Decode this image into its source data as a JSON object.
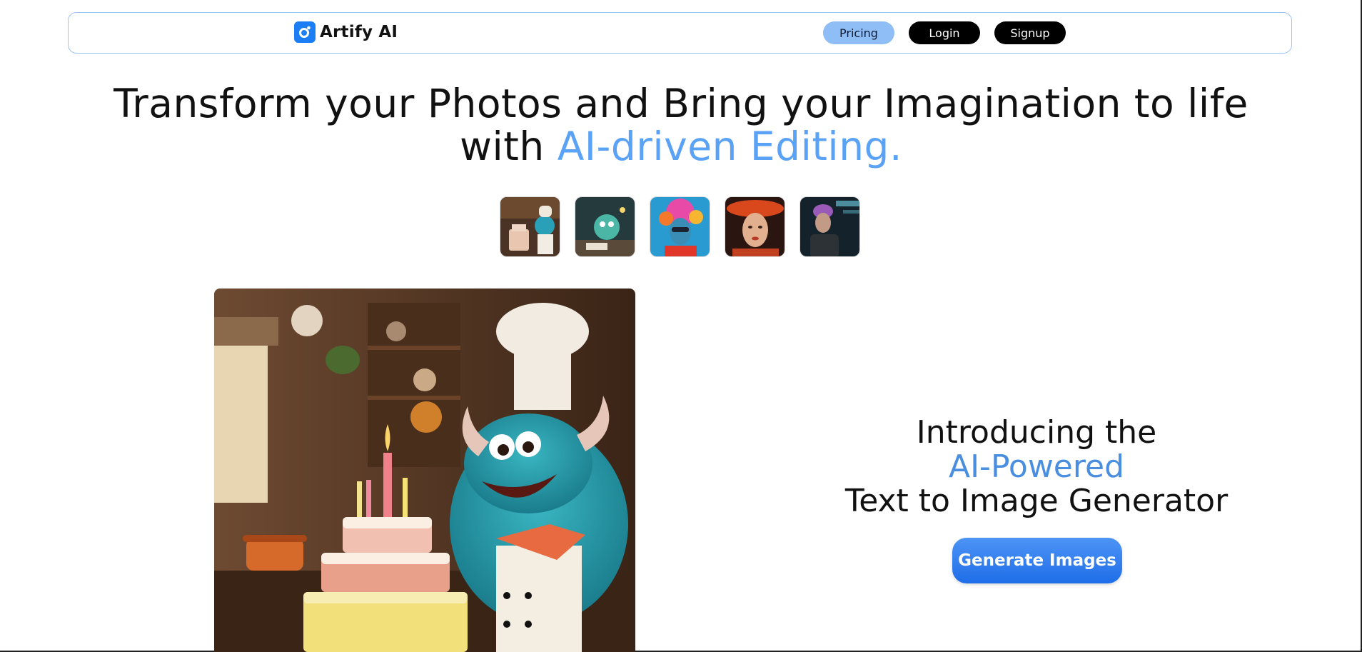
{
  "navbar": {
    "brand_name": "Artify AI",
    "buttons": {
      "pricing": "Pricing",
      "login": "Login",
      "signup": "Signup"
    }
  },
  "hero": {
    "title_part1": "Transform your Photos and Bring your Imagination to life",
    "title_part2_prefix": "with ",
    "title_part2_accent": "AI-driven Editing."
  },
  "thumbnails": [
    {
      "name": "monster-chef-cake-thumbnail"
    },
    {
      "name": "monster-desk-thumbnail"
    },
    {
      "name": "colorful-clown-woman-thumbnail"
    },
    {
      "name": "woman-red-hat-thumbnail"
    },
    {
      "name": "cyberpunk-woman-thumbnail"
    }
  ],
  "feature": {
    "line1": "Introducing the",
    "line2": "AI-Powered",
    "line3": "Text to Image Generator",
    "cta": "Generate Images"
  },
  "colors": {
    "accent": "#5aa2f5",
    "primary_button": "#1f6ee8",
    "pricing_button": "#8fbdf5"
  }
}
